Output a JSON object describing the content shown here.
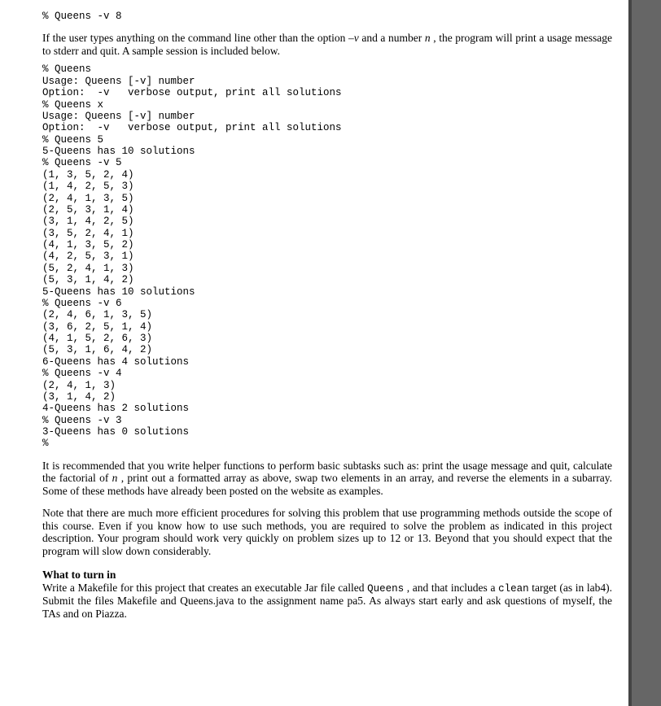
{
  "code_blocks": {
    "intro": "% Queens -v 8",
    "session": "% Queens\nUsage: Queens [-v] number\nOption:  -v   verbose output, print all solutions\n% Queens x\nUsage: Queens [-v] number\nOption:  -v   verbose output, print all solutions\n% Queens 5\n5-Queens has 10 solutions\n% Queens -v 5\n(1, 3, 5, 2, 4)\n(1, 4, 2, 5, 3)\n(2, 4, 1, 3, 5)\n(2, 5, 3, 1, 4)\n(3, 1, 4, 2, 5)\n(3, 5, 2, 4, 1)\n(4, 1, 3, 5, 2)\n(4, 2, 5, 3, 1)\n(5, 2, 4, 1, 3)\n(5, 3, 1, 4, 2)\n5-Queens has 10 solutions\n% Queens -v 6\n(2, 4, 6, 1, 3, 5)\n(3, 6, 2, 5, 1, 4)\n(4, 1, 5, 2, 6, 3)\n(5, 3, 1, 6, 4, 2)\n6-Queens has 4 solutions\n% Queens -v 4\n(2, 4, 1, 3)\n(3, 1, 4, 2)\n4-Queens has 2 solutions\n% Queens -v 3\n3-Queens has 0 solutions\n%"
  },
  "paragraphs": {
    "p1": {
      "t1": "If the user types anything on the command line other than the option ",
      "flag": "–v",
      "t2": " and a number ",
      "n": "n",
      "t3": ", the program will print a usage message to stderr and quit.  A sample session is included below."
    },
    "p2": {
      "t1": "It is recommended that you write helper functions to perform basic subtasks such as:  print the usage message and quit, calculate the factorial of ",
      "n": "n",
      "t2": ", print out a formatted array as above, swap two elements in an array, and reverse the elements in a subarray.  Some of these methods have already been posted on the website as examples."
    },
    "p3": "Note that there are much more efficient procedures for solving this problem that use programming methods outside the scope of this course.  Even if you know how to use such methods, you are required to solve the problem as indicated in this project description.  Your program should work very quickly on problem sizes up to 12 or 13.  Beyond that you should expect that the program will slow down considerably.",
    "p4": {
      "t1": "Write a Makefile for this project that creates an executable Jar file called ",
      "code1": "Queens",
      "t2": ", and that includes a ",
      "code2": "clean",
      "t3": " target (as in lab4).  Submit the files Makefile and Queens.java to the assignment name pa5.  As always start early and ask questions of myself, the TAs and on Piazza."
    }
  },
  "headings": {
    "turn_in": "What to turn in"
  }
}
